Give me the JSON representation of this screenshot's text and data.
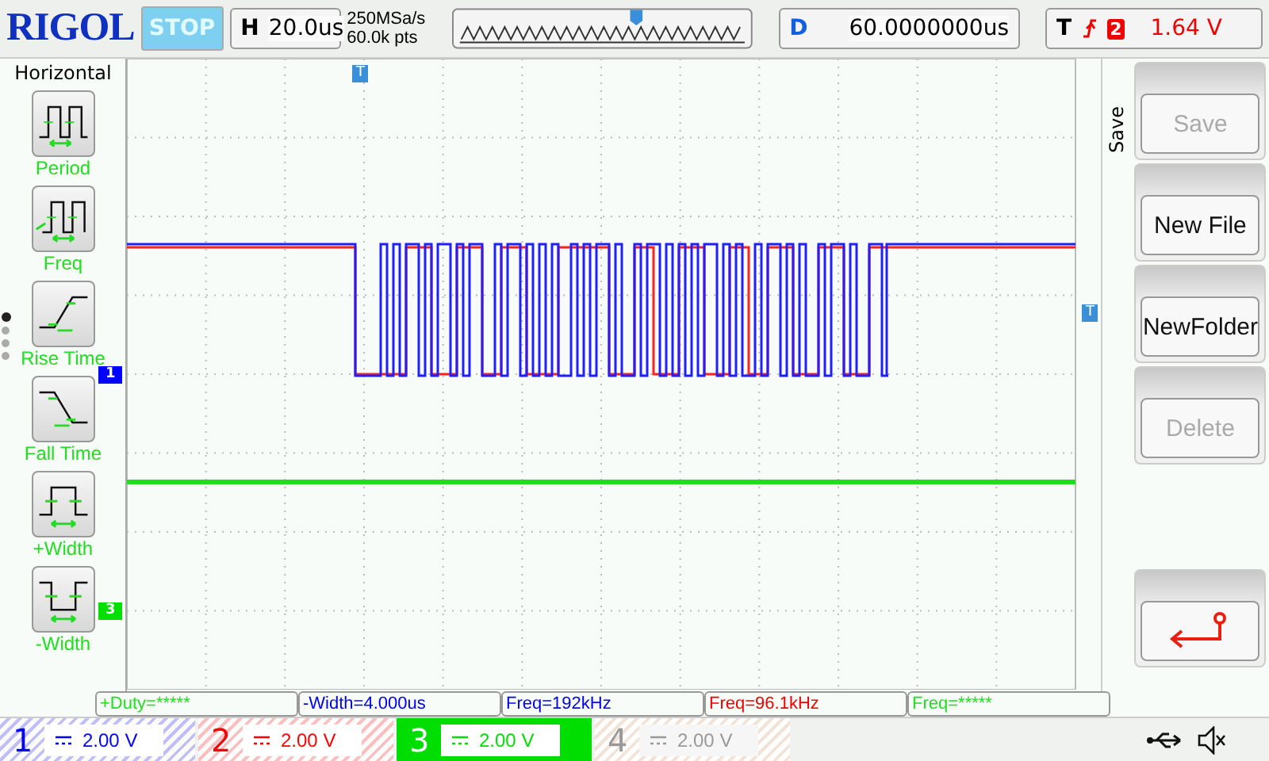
{
  "top_bar": {
    "brand": "RIGOL",
    "run_state": "STOP",
    "horizontal": {
      "label": "H",
      "timebase": "20.0us",
      "sample_rate": "250MSa/s",
      "memory_depth": "60.0k pts"
    },
    "delay": {
      "label": "D",
      "value": "60.0000000us"
    },
    "trigger": {
      "label": "T",
      "source": "2",
      "level": "1.64 V"
    }
  },
  "left_menu": {
    "title": "Horizontal",
    "pages": [
      {
        "selected": true
      },
      {
        "selected": false
      },
      {
        "selected": false
      },
      {
        "selected": false
      }
    ],
    "items": [
      {
        "kind": "period",
        "label": "Period"
      },
      {
        "kind": "freq",
        "label": "Freq"
      },
      {
        "kind": "rise",
        "label": "Rise Time"
      },
      {
        "kind": "fall",
        "label": "Fall Time"
      },
      {
        "kind": "pwidth",
        "label": "+Width"
      },
      {
        "kind": "nwidth",
        "label": "-Width"
      }
    ]
  },
  "markers": [
    {
      "label": "1",
      "color": "#0000ff"
    },
    {
      "label": "3",
      "color": "#00e000"
    }
  ],
  "trigger_markers": [
    {
      "label": "T"
    },
    {
      "label": "T"
    }
  ],
  "right_menu": {
    "title": "Save",
    "buttons": [
      {
        "kind": "text",
        "label": "Save",
        "disabled": true
      },
      {
        "kind": "text",
        "label": "New File",
        "disabled": false
      },
      {
        "kind": "text",
        "label": "NewFolder",
        "disabled": false
      },
      {
        "kind": "text",
        "label": "Delete",
        "disabled": true
      },
      {
        "kind": "spacer"
      },
      {
        "kind": "back",
        "disabled": false
      }
    ]
  },
  "measurements": [
    {
      "text": "+Duty=*****",
      "color": "#22dd22"
    },
    {
      "text": "-Width=4.000us",
      "color": "#0000ee"
    },
    {
      "text": "Freq=192kHz",
      "color": "#0000ee"
    },
    {
      "text": "Freq=96.1kHz",
      "color": "#ee0000"
    },
    {
      "text": "Freq=*****",
      "color": "#22dd22"
    }
  ],
  "channels": [
    {
      "number": "1",
      "scale": "2.00 V",
      "color": "#0000ff",
      "enabled": true,
      "selected": false
    },
    {
      "number": "2",
      "scale": "2.00 V",
      "color": "#ff0000",
      "enabled": true,
      "selected": false
    },
    {
      "number": "3",
      "scale": "2.00 V",
      "color": "#00dd00",
      "enabled": true,
      "selected": true
    },
    {
      "number": "4",
      "scale": "2.00 V",
      "color": "#999999",
      "enabled": false,
      "selected": false
    }
  ]
}
